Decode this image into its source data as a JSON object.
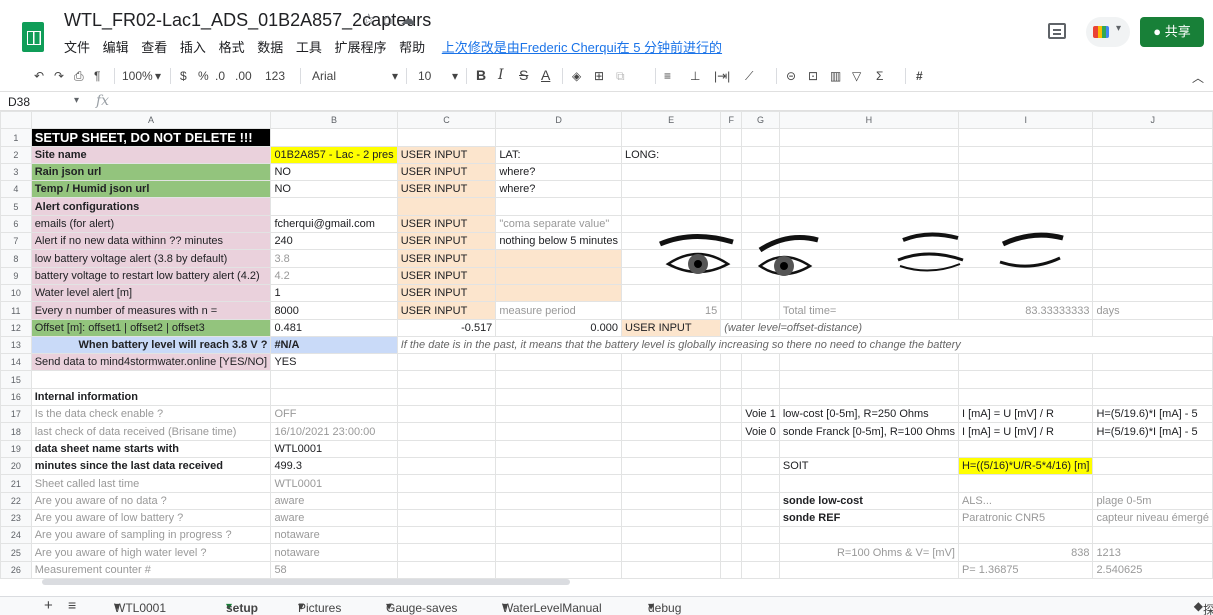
{
  "doc": {
    "title": "WTL_FR02-Lac1_ADS_01B2A857_2capteurs",
    "last_edit": "上次修改是由Frederic Cherqui在 5 分钟前进行的",
    "menus": [
      "文件",
      "编辑",
      "查看",
      "插入",
      "格式",
      "数据",
      "工具",
      "扩展程序",
      "帮助"
    ],
    "share_label": "共享"
  },
  "toolbar": {
    "zoom": "100%",
    "currency": "$",
    "percent": "%",
    "dec_less": ".0",
    "dec_more": ".00",
    "num_format": "123",
    "font": "Arial",
    "font_size": "10",
    "bold": "B",
    "italic": "I",
    "strike": "S",
    "text_color": "A"
  },
  "formula_bar": {
    "cell_ref": "D38",
    "fx": "fx",
    "content": ""
  },
  "columns": [
    "A",
    "B",
    "C",
    "D",
    "E",
    "F",
    "G",
    "H",
    "I",
    "J"
  ],
  "rows": [
    {
      "n": "1",
      "cells": [
        {
          "t": "SETUP SHEET, DO NOT DELETE !!!",
          "c": "black"
        }
      ]
    },
    {
      "n": "2",
      "cells": [
        {
          "t": "Site name",
          "c": "pink bold"
        },
        {
          "t": "01B2A857 - Lac - 2 pres",
          "c": "yellow"
        },
        {
          "t": "USER INPUT",
          "c": "peach"
        },
        {
          "t": "LAT:"
        },
        {
          "t": "LONG:"
        }
      ]
    },
    {
      "n": "3",
      "cells": [
        {
          "t": "Rain json url",
          "c": "green bold"
        },
        {
          "t": "NO"
        },
        {
          "t": "USER INPUT",
          "c": "peach"
        },
        {
          "t": "where?"
        }
      ]
    },
    {
      "n": "4",
      "cells": [
        {
          "t": "Temp / Humid json url",
          "c": "green bold"
        },
        {
          "t": "NO"
        },
        {
          "t": "USER INPUT",
          "c": "peach"
        },
        {
          "t": "where?"
        }
      ]
    },
    {
      "n": "5",
      "cells": [
        {
          "t": "Alert configurations",
          "c": "pink bold"
        },
        {
          "t": ""
        },
        {
          "t": "",
          "c": "peach"
        }
      ]
    },
    {
      "n": "6",
      "cells": [
        {
          "t": "emails (for alert)",
          "c": "pink ind"
        },
        {
          "t": "fcherqui@gmail.com"
        },
        {
          "t": "USER INPUT",
          "c": "peach"
        },
        {
          "t": "\"coma separate value\"",
          "c": "gray"
        }
      ]
    },
    {
      "n": "7",
      "cells": [
        {
          "t": "Alert if no new data withinn ?? minutes",
          "c": "pink ind"
        },
        {
          "t": "240"
        },
        {
          "t": "USER INPUT",
          "c": "peach"
        },
        {
          "t": "nothing below 5 minutes"
        }
      ]
    },
    {
      "n": "8",
      "cells": [
        {
          "t": "low battery voltage alert (3.8 by default)",
          "c": "pink ind"
        },
        {
          "t": "3.8",
          "c": "gray"
        },
        {
          "t": "USER INPUT",
          "c": "peach"
        },
        {
          "t": "",
          "c": "peach"
        }
      ]
    },
    {
      "n": "9",
      "cells": [
        {
          "t": "battery voltage to restart low battery alert (4.2)",
          "c": "pink ind"
        },
        {
          "t": "4.2",
          "c": "gray"
        },
        {
          "t": "USER INPUT",
          "c": "peach"
        },
        {
          "t": "",
          "c": "peach"
        }
      ]
    },
    {
      "n": "10",
      "cells": [
        {
          "t": "Water level alert [m]",
          "c": "pink ind"
        },
        {
          "t": "1"
        },
        {
          "t": "USER INPUT",
          "c": "peach"
        },
        {
          "t": "",
          "c": "peach"
        }
      ]
    },
    {
      "n": "11",
      "cells": [
        {
          "t": "Every n number of measures with n =",
          "c": "pink ind"
        },
        {
          "t": "8000"
        },
        {
          "t": "USER INPUT",
          "c": "peach"
        },
        {
          "t": "measure period",
          "c": "gray"
        },
        {
          "t": "15",
          "c": "gray right"
        },
        {
          "t": ""
        },
        {
          "t": ""
        },
        {
          "t": "Total time=",
          "c": "gray"
        },
        {
          "t": "83.33333333",
          "c": "gray right"
        },
        {
          "t": "days",
          "c": "gray"
        }
      ]
    },
    {
      "n": "12",
      "cells": [
        {
          "t": "Offset [m]: offset1 | offset2 | offset3",
          "c": "green ind"
        },
        {
          "t": "0.481"
        },
        {
          "t": "-0.517",
          "c": "right"
        },
        {
          "t": "0.000",
          "c": "right"
        },
        {
          "t": "USER INPUT",
          "c": "peach"
        },
        {
          "t": "(water level=offset-distance)",
          "c": "ital"
        }
      ]
    },
    {
      "n": "13",
      "cells": [
        {
          "t": "When battery level will reach 3.8 V ?",
          "c": "blue bold right"
        },
        {
          "t": "#N/A",
          "c": "blue bold"
        },
        {
          "t": "If the date is in the past, it means that the battery level is globally increasing so there no need to change the battery",
          "c": "ital"
        }
      ]
    },
    {
      "n": "14",
      "cells": [
        {
          "t": "Send data to mind4stormwater.online [YES/NO]",
          "c": "pink"
        },
        {
          "t": "YES"
        }
      ]
    },
    {
      "n": "15",
      "cells": []
    },
    {
      "n": "16",
      "cells": [
        {
          "t": "Internal information",
          "c": "bold"
        }
      ]
    },
    {
      "n": "17",
      "cells": [
        {
          "t": "Is the data check enable ?",
          "c": "gray"
        },
        {
          "t": "OFF",
          "c": "gray"
        },
        {
          "t": ""
        },
        {
          "t": ""
        },
        {
          "t": ""
        },
        {
          "t": ""
        },
        {
          "t": "Voie 1",
          "c": "right"
        },
        {
          "t": "low-cost [0-5m], R=250 Ohms"
        },
        {
          "t": "I [mA] = U [mV] / R"
        },
        {
          "t": "H=(5/19.6)*I [mA] - 5"
        }
      ]
    },
    {
      "n": "18",
      "cells": [
        {
          "t": "last check of data received (Brisane time)",
          "c": "gray"
        },
        {
          "t": "16/10/2021 23:00:00",
          "c": "gray"
        },
        {
          "t": ""
        },
        {
          "t": ""
        },
        {
          "t": ""
        },
        {
          "t": ""
        },
        {
          "t": "Voie 0",
          "c": "right"
        },
        {
          "t": "sonde Franck [0-5m], R=100 Ohms"
        },
        {
          "t": "I [mA] = U [mV] / R"
        },
        {
          "t": "H=(5/19.6)*I [mA] - 5"
        }
      ]
    },
    {
      "n": "19",
      "cells": [
        {
          "t": "data sheet name starts with",
          "c": "bold"
        },
        {
          "t": "WTL0001"
        }
      ]
    },
    {
      "n": "20",
      "cells": [
        {
          "t": "minutes since the last data received",
          "c": "bold"
        },
        {
          "t": "499.3"
        },
        {
          "t": ""
        },
        {
          "t": ""
        },
        {
          "t": ""
        },
        {
          "t": ""
        },
        {
          "t": ""
        },
        {
          "t": "SOIT"
        },
        {
          "t": "H=((5/16)*U/R-5*4/16) [m]",
          "c": "yellow"
        }
      ]
    },
    {
      "n": "21",
      "cells": [
        {
          "t": "Sheet called last time",
          "c": "gray"
        },
        {
          "t": "WTL0001",
          "c": "gray"
        }
      ]
    },
    {
      "n": "22",
      "cells": [
        {
          "t": "Are you aware of no data ?",
          "c": "gray"
        },
        {
          "t": "aware",
          "c": "gray"
        },
        {
          "t": ""
        },
        {
          "t": ""
        },
        {
          "t": ""
        },
        {
          "t": ""
        },
        {
          "t": ""
        },
        {
          "t": "sonde low-cost",
          "c": "bold"
        },
        {
          "t": "ALS...",
          "c": "gray"
        },
        {
          "t": "plage 0-5m",
          "c": "gray"
        }
      ]
    },
    {
      "n": "23",
      "cells": [
        {
          "t": "Are you aware of low battery ?",
          "c": "gray"
        },
        {
          "t": "aware",
          "c": "gray"
        },
        {
          "t": ""
        },
        {
          "t": ""
        },
        {
          "t": ""
        },
        {
          "t": ""
        },
        {
          "t": ""
        },
        {
          "t": "sonde REF",
          "c": "bold"
        },
        {
          "t": "Paratronic CNR5",
          "c": "gray"
        },
        {
          "t": "capteur niveau émergé",
          "c": "gray"
        }
      ]
    },
    {
      "n": "24",
      "cells": [
        {
          "t": "Are you aware of sampling in progress ?",
          "c": "gray"
        },
        {
          "t": "notaware",
          "c": "gray"
        }
      ]
    },
    {
      "n": "25",
      "cells": [
        {
          "t": "Are you aware of high water level ?",
          "c": "gray"
        },
        {
          "t": "notaware",
          "c": "gray"
        },
        {
          "t": ""
        },
        {
          "t": ""
        },
        {
          "t": ""
        },
        {
          "t": ""
        },
        {
          "t": ""
        },
        {
          "t": "R=100 Ohms & V= [mV]",
          "c": "gray right"
        },
        {
          "t": "838",
          "c": "gray right"
        },
        {
          "t": "1213",
          "c": "gray"
        }
      ]
    },
    {
      "n": "26",
      "cells": [
        {
          "t": "Measurement counter #",
          "c": "gray"
        },
        {
          "t": "58",
          "c": "gray"
        },
        {
          "t": ""
        },
        {
          "t": ""
        },
        {
          "t": ""
        },
        {
          "t": ""
        },
        {
          "t": ""
        },
        {
          "t": ""
        },
        {
          "t": "P= 1.36875",
          "c": "gray"
        },
        {
          "t": "2.540625",
          "c": "gray"
        }
      ]
    }
  ],
  "tabs": [
    "WTL0001",
    "setup",
    "Pictures",
    "Gauge-saves",
    "WaterLevelManual",
    "debug"
  ],
  "active_tab": "setup",
  "explore_label": "探索"
}
